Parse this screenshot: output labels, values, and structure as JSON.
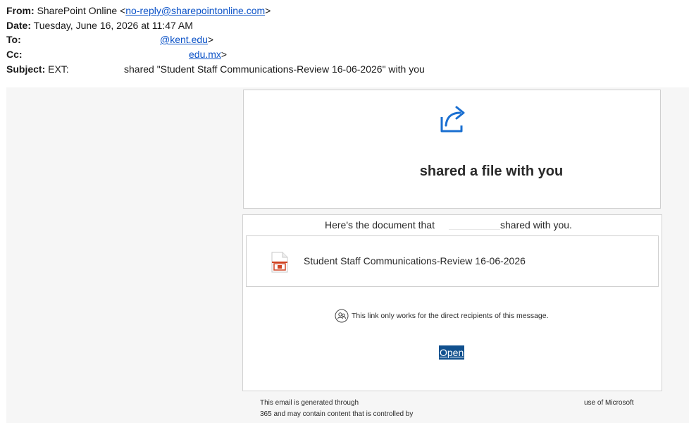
{
  "header": {
    "from_label": "From:",
    "from_name": "SharePoint Online <",
    "from_email": "no-reply@sharepointonline.com",
    "from_close": ">",
    "date_label": "Date:",
    "date_value": "Tuesday, June 16, 2026 at 11:47 AM",
    "to_label": "To:",
    "to_email": "@kent.edu",
    "to_close": ">",
    "cc_label": "Cc:",
    "cc_email": "edu.mx",
    "cc_close": ">",
    "subject_label": "Subject:",
    "subject_prefix": "EXT:",
    "subject_text": "shared \"Student Staff Communications-Review 16-06-2026\" with you"
  },
  "card1": {
    "title": "shared a file with you",
    "icon": "share-icon",
    "accent": "#1a6fd1"
  },
  "card2": {
    "intro_a": "Here's the document that",
    "intro_b": "shared with you.",
    "file_name": "Student Staff Communications-Review 16-06-2026",
    "file_icon": "powerpoint-file-icon",
    "notice": "This link only works for the direct recipients of this message.",
    "notice_icon": "people-icon",
    "open_label": "Open",
    "button_color": "#10508e"
  },
  "footer": {
    "line1": "This email is generated through",
    "line2": "365 and may contain content that is controlled by",
    "line1_right": "use of Microsoft"
  }
}
